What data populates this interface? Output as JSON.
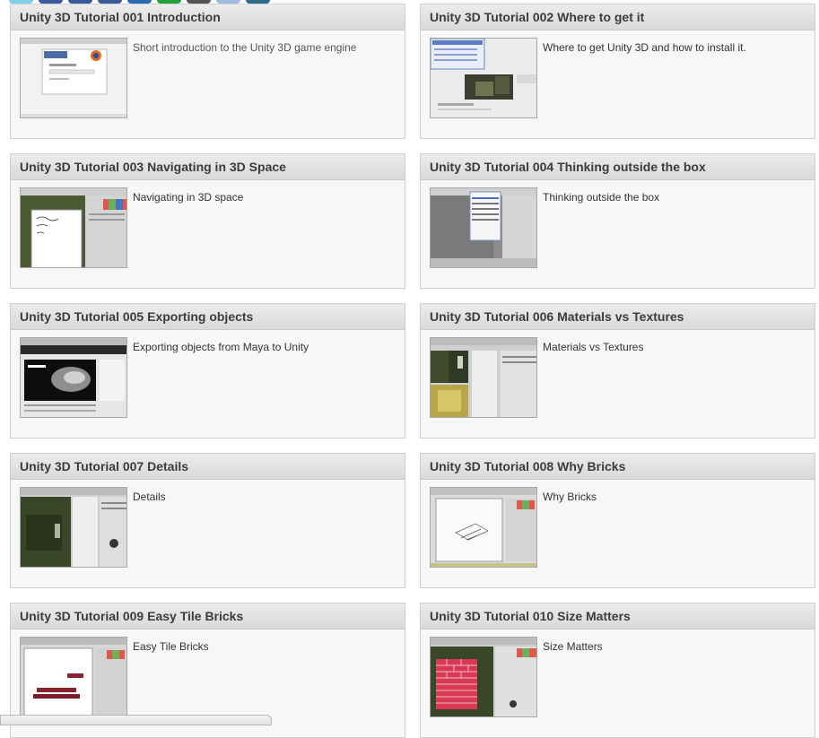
{
  "share_colors": [
    "#7fd0e6",
    "#3b5998",
    "#3b5998",
    "#3b5998",
    "#2a6ab0",
    "#22a33a",
    "#555555",
    "#9ebde0",
    "#2f6b8a"
  ],
  "tutorials": [
    {
      "title": "Unity 3D Tutorial 001 Introduction",
      "desc": "Short introduction to the Unity 3D game engine",
      "thumb_icon": "firefox-page-screenshot"
    },
    {
      "title": "Unity 3D Tutorial 002 Where to get it",
      "desc": "Where to get Unity 3D and how to install it.",
      "thumb_icon": "unity-website-screenshot"
    },
    {
      "title": "Unity 3D Tutorial 003 Navigating in 3D Space",
      "desc": "Navigating in 3D space",
      "thumb_icon": "unity-editor-notes-screenshot"
    },
    {
      "title": "Unity 3D Tutorial 004 Thinking outside the box",
      "desc": "Thinking outside the box",
      "thumb_icon": "unity-editor-menu-screenshot"
    },
    {
      "title": "Unity 3D Tutorial 005 Exporting objects",
      "desc": "Exporting objects from Maya to Unity",
      "thumb_icon": "autodesk-page-screenshot"
    },
    {
      "title": "Unity 3D Tutorial 006 Materials vs Textures",
      "desc": "Materials vs Textures",
      "thumb_icon": "unity-materials-screenshot"
    },
    {
      "title": "Unity 3D Tutorial 007 Details",
      "desc": "Details",
      "thumb_icon": "unity-scene-screenshot"
    },
    {
      "title": "Unity 3D Tutorial 008 Why Bricks",
      "desc": "Why Bricks",
      "thumb_icon": "unity-wireframe-screenshot"
    },
    {
      "title": "Unity 3D Tutorial 009 Easy Tile Bricks",
      "desc": "Easy Tile Bricks",
      "thumb_icon": "unity-tile-bricks-screenshot"
    },
    {
      "title": "Unity 3D Tutorial 010 Size Matters",
      "desc": "Size Matters",
      "thumb_icon": "unity-brick-wall-screenshot"
    }
  ]
}
